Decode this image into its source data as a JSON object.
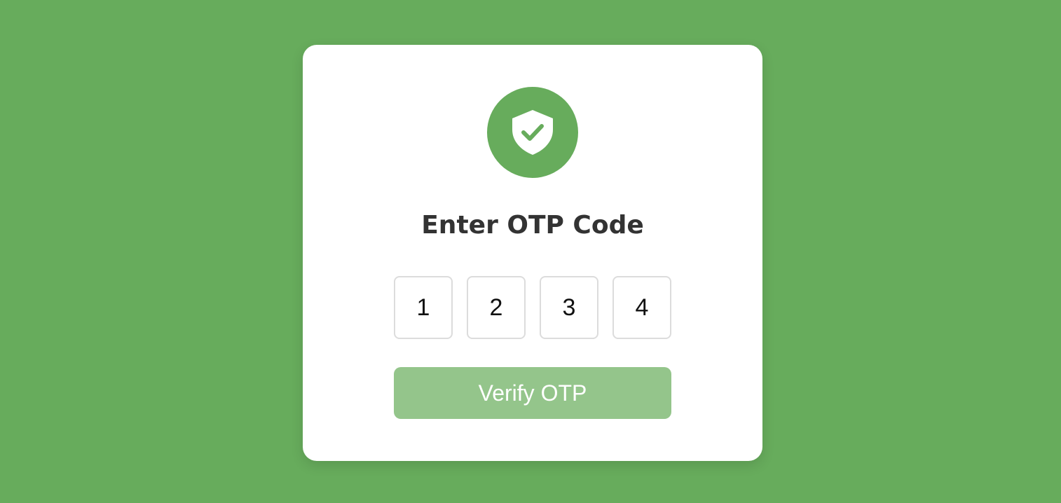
{
  "colors": {
    "background": "#67ac5c",
    "card": "#ffffff",
    "accent": "#67ac5c",
    "button": "#94c58b",
    "title_text": "#333333",
    "input_border": "#dcdcdc"
  },
  "header": {
    "icon": "shield-check-icon",
    "title": "Enter OTP Code"
  },
  "otp": {
    "digits": [
      "1",
      "2",
      "3",
      "4"
    ]
  },
  "actions": {
    "verify_label": "Verify OTP"
  }
}
